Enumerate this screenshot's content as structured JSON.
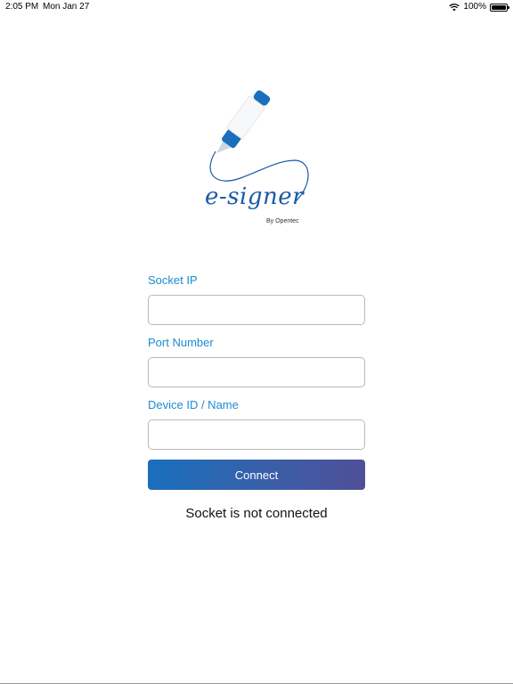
{
  "status_bar": {
    "time": "2:05 PM",
    "date": "Mon Jan 27",
    "battery": "100%",
    "battery_level": 1.0,
    "icons": [
      "wifi-icon",
      "battery-icon"
    ]
  },
  "logo": {
    "wordmark": "e-signer",
    "byline": "By Opentec",
    "icon": "pen-icon",
    "brand_color": "#1a5aa6"
  },
  "form": {
    "socket_ip": {
      "label": "Socket IP",
      "value": "",
      "placeholder": ""
    },
    "port_number": {
      "label": "Port Number",
      "value": "",
      "placeholder": ""
    },
    "device_id": {
      "label": "Device ID / Name",
      "value": "",
      "placeholder": ""
    },
    "connect_label": "Connect",
    "label_color": "#1a8dd0"
  },
  "connection_status": "Socket is not connected"
}
